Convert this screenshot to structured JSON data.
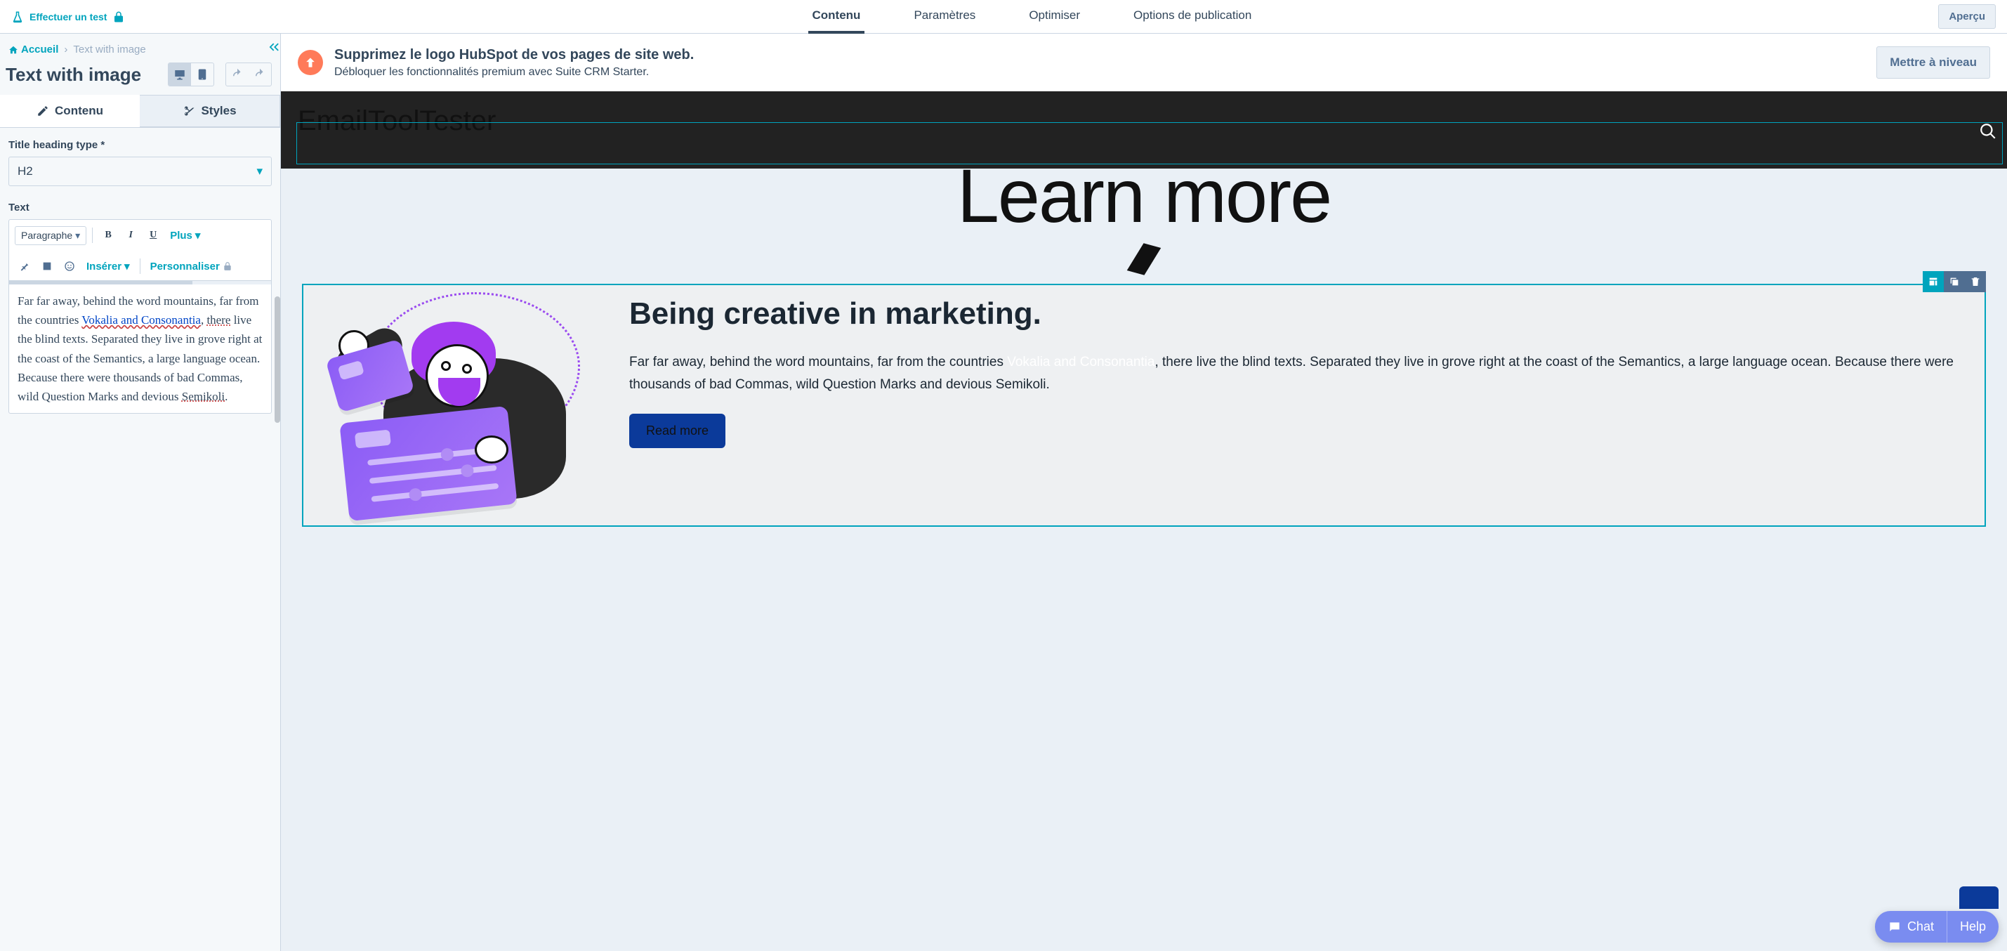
{
  "topbar": {
    "test_label": "Effectuer un test",
    "nav": {
      "content": "Contenu",
      "settings": "Paramètres",
      "optimize": "Optimiser",
      "publish": "Options de publication"
    },
    "preview_label": "Aperçu"
  },
  "sidepanel": {
    "breadcrumb": {
      "home": "Accueil",
      "current": "Text with image"
    },
    "title": "Text with image",
    "tabs": {
      "content": "Contenu",
      "styles": "Styles"
    },
    "fields": {
      "heading_type_label": "Title heading type *",
      "heading_type_value": "H2",
      "text_label": "Text"
    },
    "rte": {
      "block_selector": "Paragraphe",
      "more_label": "Plus",
      "insert_label": "Insérer",
      "personalize_label": "Personnaliser",
      "content_pre_link": "Far far away, behind the word mountains, far from the countries ",
      "content_link": "Vokalia and Consonantia",
      "content_post_link_a": ", ",
      "content_spell_a": "there",
      "content_mid": " live the blind texts. Separated they live in grove right at the coast of the Semantics, a large language ocean. Because there were thousands of bad Commas, wild Question Marks and devious ",
      "content_spell_b": "Semikoli",
      "content_end": "."
    }
  },
  "banner": {
    "title": "Supprimez le logo HubSpot de vos pages de site web.",
    "subtitle": "Débloquer les fonctionnalités premium avec Suite CRM Starter.",
    "cta": "Mettre à niveau"
  },
  "preview": {
    "brand": "EmailToolTester",
    "hero_title": "Learn more",
    "module": {
      "heading": "Being creative in marketing.",
      "body_pre": "Far far away, behind the word mountains, far from the countries ",
      "body_hl": "Vokalia and Consonantia",
      "body_post": ", there live the blind texts. Separated they live in grove right at the coast of the Semantics, a large language ocean. Because there were thousands of bad Commas, wild Question Marks and devious Semikoli.",
      "cta": "Read more"
    }
  },
  "chat": {
    "chat_label": "Chat",
    "help_label": "Help"
  }
}
